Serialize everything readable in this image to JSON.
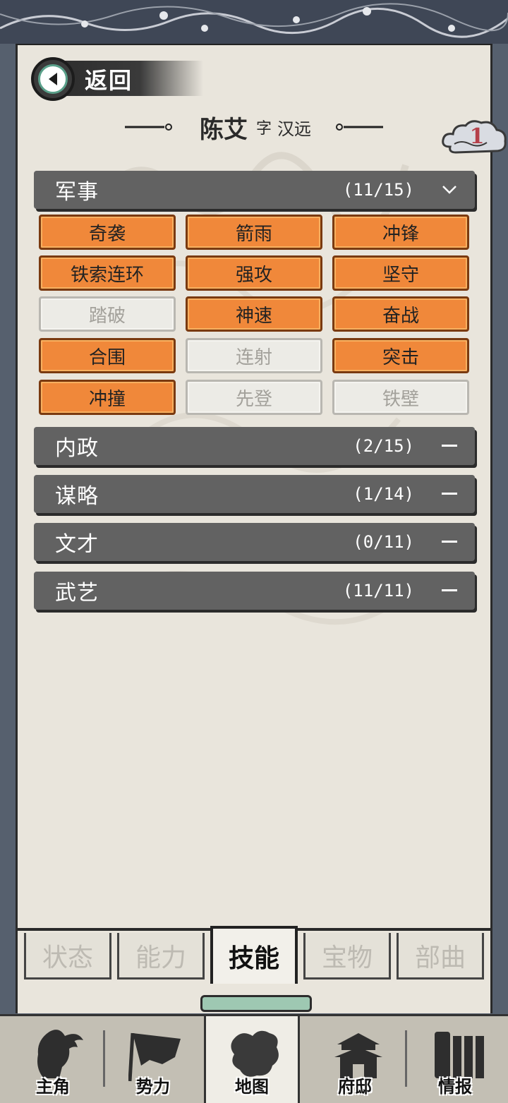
{
  "header": {
    "back_label": "返回",
    "name": "陈艾",
    "zi_label": "字",
    "zi_value": "汉远",
    "badge_count": "1"
  },
  "sections": [
    {
      "title": "军事",
      "count": "(11/15)",
      "toggle": "chevron-down-icon",
      "expanded": true
    },
    {
      "title": "内政",
      "count": "(2/15)",
      "toggle": "minus-icon"
    },
    {
      "title": "谋略",
      "count": "(1/14)",
      "toggle": "minus-icon"
    },
    {
      "title": "文才",
      "count": "(0/11)",
      "toggle": "minus-icon"
    },
    {
      "title": "武艺",
      "count": "(11/11)",
      "toggle": "minus-icon"
    }
  ],
  "military_skills": [
    {
      "label": "奇袭",
      "learned": true
    },
    {
      "label": "箭雨",
      "learned": true
    },
    {
      "label": "冲锋",
      "learned": true
    },
    {
      "label": "铁索连环",
      "learned": true
    },
    {
      "label": "强攻",
      "learned": true
    },
    {
      "label": "坚守",
      "learned": true
    },
    {
      "label": "踏破",
      "learned": false
    },
    {
      "label": "神速",
      "learned": true
    },
    {
      "label": "奋战",
      "learned": true
    },
    {
      "label": "合围",
      "learned": true
    },
    {
      "label": "连射",
      "learned": false
    },
    {
      "label": "突击",
      "learned": true
    },
    {
      "label": "冲撞",
      "learned": true
    },
    {
      "label": "先登",
      "learned": false
    },
    {
      "label": "铁壁",
      "learned": false
    }
  ],
  "tabs": [
    {
      "label": "状态"
    },
    {
      "label": "能力"
    },
    {
      "label": "技能",
      "active": true
    },
    {
      "label": "宝物"
    },
    {
      "label": "部曲"
    }
  ],
  "bottom_nav": [
    {
      "label": "主角",
      "icon": "hero-portrait-icon"
    },
    {
      "label": "势力",
      "icon": "banner-flag-icon"
    },
    {
      "label": "地图",
      "icon": "map-icon",
      "active": true
    },
    {
      "label": "府邸",
      "icon": "mansion-icon"
    },
    {
      "label": "情报",
      "icon": "scroll-books-icon"
    }
  ],
  "colors": {
    "skill_learned": "#f0883a",
    "skill_unlearned": "#ecebe6",
    "section_bar": "#626262",
    "paper": "#e9e5dc",
    "badge_number": "#b5404a"
  }
}
